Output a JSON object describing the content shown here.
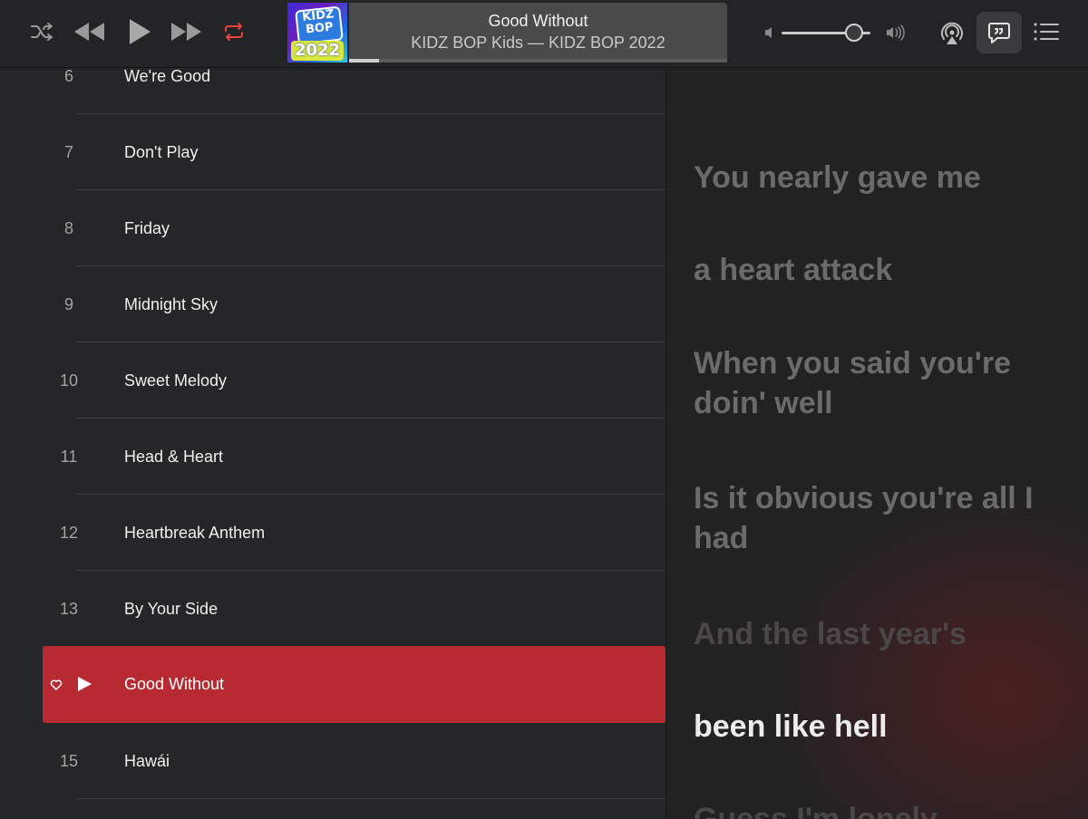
{
  "toolbar": {
    "icons": [
      "shuffle-icon",
      "previous-icon",
      "play-icon",
      "next-icon",
      "repeat-icon",
      "volume-low-icon",
      "volume-high-icon",
      "airplay-icon",
      "lyrics-icon",
      "queue-icon"
    ],
    "accent_repeat_color": "#e8423f"
  },
  "now_playing": {
    "title": "Good Without",
    "subtitle": "KIDZ BOP Kids — KIDZ BOP 2022",
    "artwork": {
      "badge_text": "KIDZ BOP",
      "year_text": "2022"
    },
    "progress": 0.08,
    "volume": 0.82
  },
  "tracks": [
    {
      "num": "6",
      "name": "We're Good"
    },
    {
      "num": "7",
      "name": "Don't Play"
    },
    {
      "num": "8",
      "name": "Friday"
    },
    {
      "num": "9",
      "name": "Midnight Sky"
    },
    {
      "num": "10",
      "name": "Sweet Melody"
    },
    {
      "num": "11",
      "name": "Head & Heart"
    },
    {
      "num": "12",
      "name": "Heartbreak Anthem"
    },
    {
      "num": "13",
      "name": "By Your Side"
    },
    {
      "num": "",
      "name": "Good Without",
      "playing": true
    },
    {
      "num": "15",
      "name": "Hawái"
    }
  ],
  "active_row_color": "#b72a31",
  "lyrics": [
    "You nearly gave me",
    "a heart attack",
    "When you said you're doin' well",
    "Is it obvious you're all I had",
    "And the last year's",
    "been like hell",
    "Guess I'm lonely"
  ],
  "current_lyric_index": 5
}
